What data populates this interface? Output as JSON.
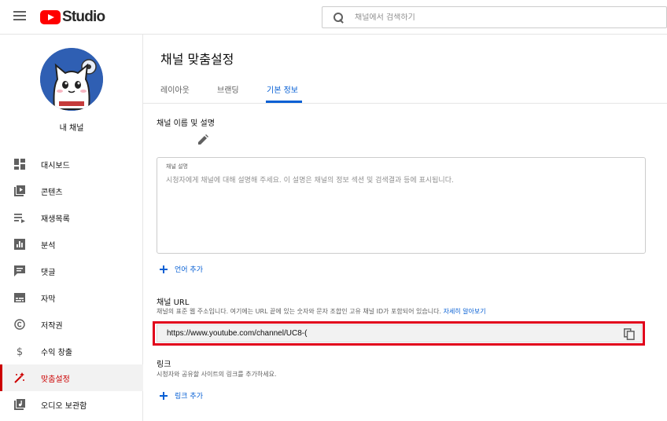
{
  "app": {
    "logo_text": "Studio",
    "brand_color": "#ff0000",
    "accent_color": "#065fd4",
    "highlight_color": "#e1001b"
  },
  "header": {
    "search_placeholder": "채널에서 검색하기"
  },
  "sidebar": {
    "channel_label": "내 채널",
    "items": [
      {
        "label": "대시보드",
        "icon": "dashboard-icon"
      },
      {
        "label": "콘텐츠",
        "icon": "content-icon"
      },
      {
        "label": "재생목록",
        "icon": "playlist-icon"
      },
      {
        "label": "분석",
        "icon": "analytics-icon"
      },
      {
        "label": "댓글",
        "icon": "comments-icon"
      },
      {
        "label": "자막",
        "icon": "subtitles-icon"
      },
      {
        "label": "저작권",
        "icon": "copyright-icon"
      },
      {
        "label": "수익 창출",
        "icon": "monetization-icon"
      },
      {
        "label": "맞춤설정",
        "icon": "customization-icon",
        "active": true
      },
      {
        "label": "오디오 보관함",
        "icon": "audio-library-icon"
      }
    ]
  },
  "main": {
    "title": "채널 맞춤설정",
    "tabs": [
      {
        "label": "레이아웃"
      },
      {
        "label": "브랜딩"
      },
      {
        "label": "기본 정보",
        "active": true
      }
    ],
    "name_section": {
      "title": "채널 이름 및 설명"
    },
    "description": {
      "label": "채널 설명",
      "placeholder": "시청자에게 채널에 대해 설명해 주세요. 이 설명은 채널의 정보 섹션 및 검색결과 등에 표시됩니다."
    },
    "add_language": "언어 추가",
    "url_section": {
      "title": "채널 URL",
      "helper": "채널의 표준 웹 주소입니다. 여기에는 URL 끝에 있는 숫자와 문자 조합인 고유 채널 ID가 포함되어 있습니다.",
      "learn_more": "자세히 알아보기",
      "value": "https://www.youtube.com/channel/UC8-("
    },
    "links_section": {
      "title": "링크",
      "helper": "시청자와 공유할 사이트의 링크를 추가하세요.",
      "add_link": "링크 추가"
    }
  }
}
